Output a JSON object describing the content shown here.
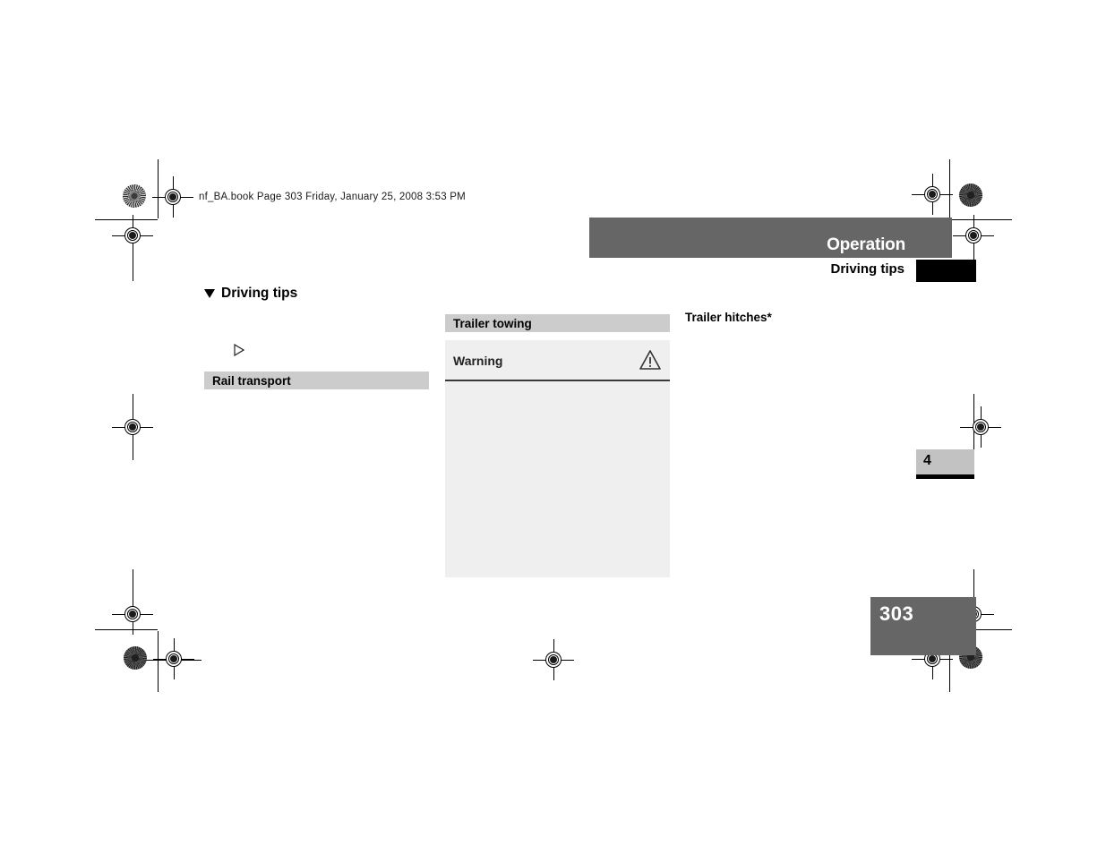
{
  "document": {
    "file_info_line": "nf_BA.book  Page 303  Friday, January 25, 2008  3:53 PM",
    "page_number": "303",
    "chapter_number": "4"
  },
  "header": {
    "chapter_title": "Operation",
    "section_title": "Driving tips"
  },
  "body": {
    "section_heading": "Driving tips",
    "down_triangle_icon": "triangle-down-icon",
    "bullet_icon": "triangle-right-outline-icon",
    "subsections": [
      {
        "label": "Rail transport"
      },
      {
        "label": "Trailer towing"
      }
    ],
    "warning_box": {
      "title": "Warning",
      "icon": "warning-triangle-icon"
    },
    "third_column_heading": "Trailer hitches*"
  },
  "print_marks": {
    "registration_icon": "registration-target-icon",
    "halftone_icon": "halftone-density-patch-icon",
    "crop_mark": "crop-mark-line"
  },
  "colors": {
    "header_band": "#666666",
    "subsection_bar": "#cccccc",
    "warning_box": "#efefef",
    "black_block": "#000000",
    "chapter_tab": "#c2c2c2"
  }
}
